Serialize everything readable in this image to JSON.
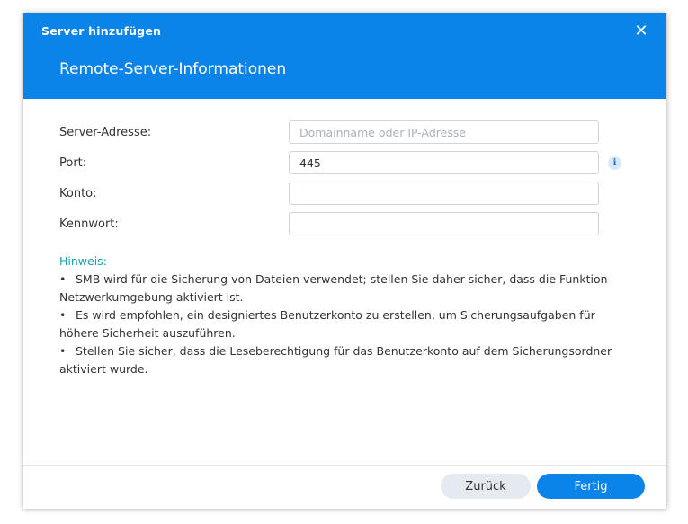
{
  "dialog": {
    "window_title": "Server hinzufügen",
    "close_glyph": "✕",
    "header_title": "Remote-Server-Informationen"
  },
  "form": {
    "server_address": {
      "label": "Server-Adresse:",
      "value": "",
      "placeholder": "Domainname oder IP-Adresse"
    },
    "port": {
      "label": "Port:",
      "value": "445",
      "info_glyph": "i"
    },
    "account": {
      "label": "Konto:",
      "value": ""
    },
    "password": {
      "label": "Kennwort:",
      "value": ""
    }
  },
  "notes": {
    "title": "Hinweis:",
    "bullet": "•",
    "items": [
      "SMB wird für die Sicherung von Dateien verwendet; stellen Sie daher sicher, dass die Funktion Netzwerkumgebung aktiviert ist.",
      "Es wird empfohlen, ein designiertes Benutzerkonto zu erstellen, um Sicherungsaufgaben für höhere Sicherheit auszuführen.",
      "Stellen Sie sicher, dass die Leseberechtigung für das Benutzerkonto auf dem Sicherungsordner aktiviert wurde."
    ]
  },
  "footer": {
    "back_label": "Zurück",
    "done_label": "Fertig"
  },
  "colors": {
    "accent": "#0a84e8",
    "note_title": "#1a9fb0",
    "secondary_button": "#e5eaf0"
  }
}
